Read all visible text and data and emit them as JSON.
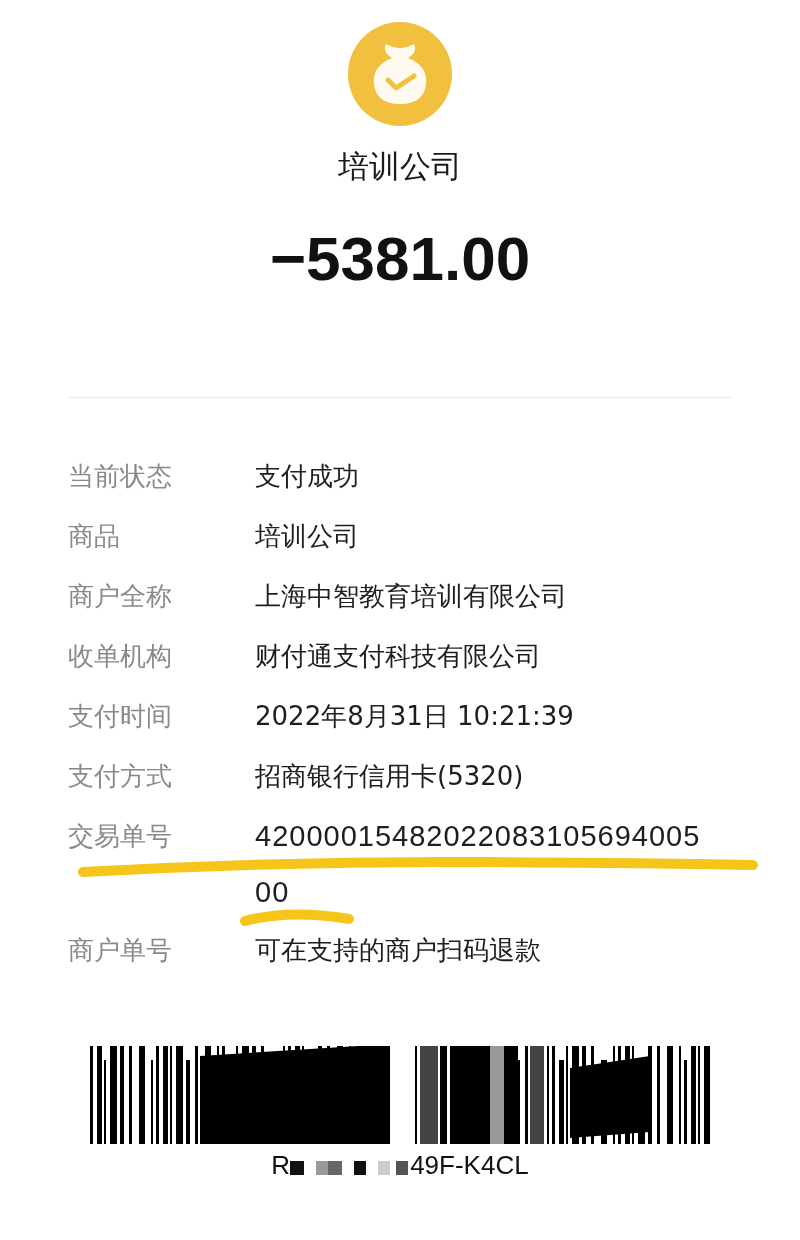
{
  "merchant_title": "培训公司",
  "amount": "−5381.00",
  "details": [
    {
      "label": "当前状态",
      "value": "支付成功",
      "highlighted": false
    },
    {
      "label": "商品",
      "value": "培训公司",
      "highlighted": false
    },
    {
      "label": "商户全称",
      "value": "上海中智教育培训有限公司",
      "highlighted": false
    },
    {
      "label": "收单机构",
      "value": "财付通支付科技有限公司",
      "highlighted": false
    },
    {
      "label": "支付时间",
      "value": "2022年8月31日 10:21:39",
      "highlighted": false
    },
    {
      "label": "支付方式",
      "value": "招商银行信用卡(5320)",
      "highlighted": false
    },
    {
      "label": "交易单号",
      "value": "4200001548202208310569400500",
      "highlighted": true
    },
    {
      "label": "商户单号",
      "value": "可在支持的商户扫码退款",
      "highlighted": false
    }
  ],
  "barcode": {
    "code_start": "R",
    "code_end": "49F-K4CL",
    "redacted": true
  }
}
